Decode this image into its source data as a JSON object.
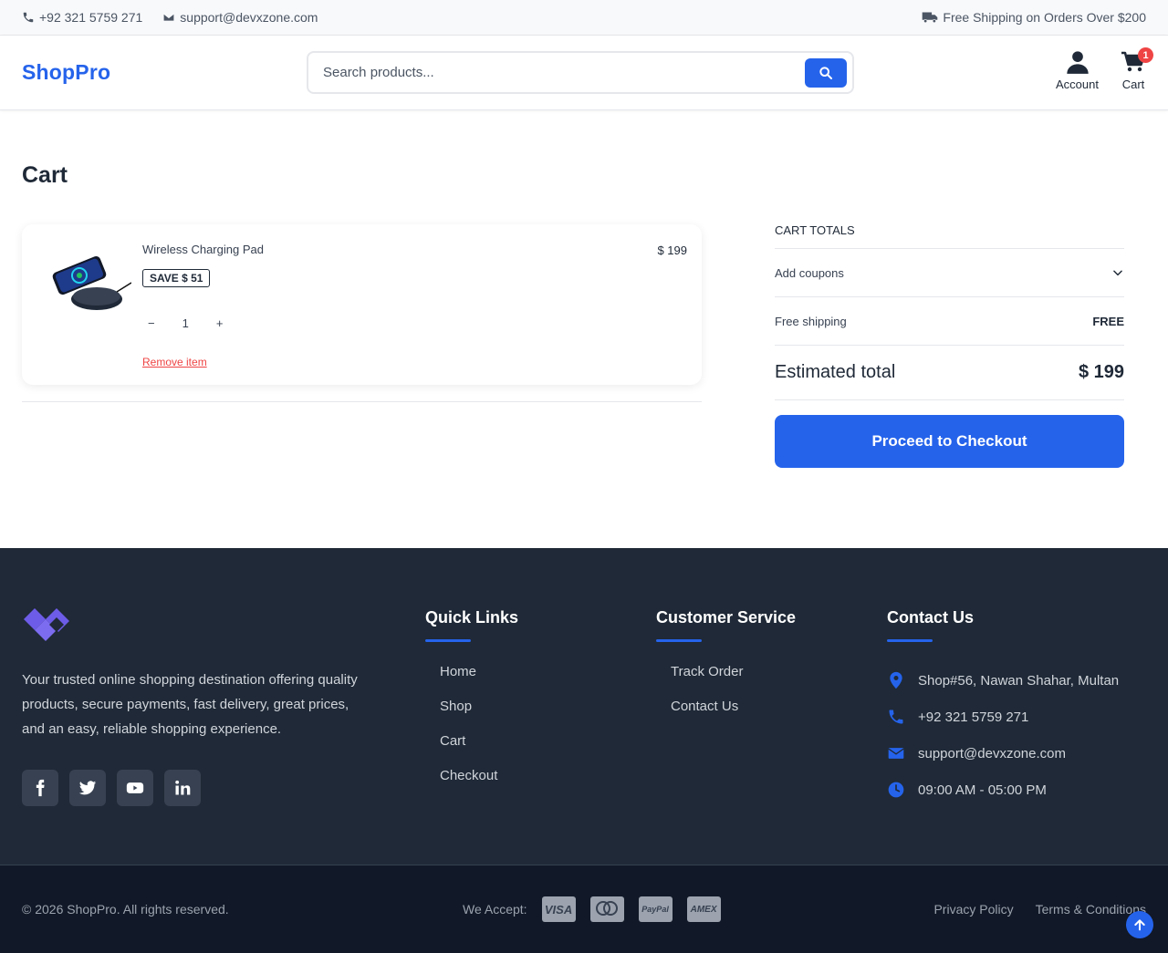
{
  "topbar": {
    "phone": "+92 321 5759 271",
    "email": "support@devxzone.com",
    "shipping": "Free Shipping on Orders Over $200"
  },
  "header": {
    "logo": "ShopPro",
    "search_placeholder": "Search products...",
    "account_label": "Account",
    "cart_label": "Cart",
    "cart_count": "1"
  },
  "cart": {
    "title": "Cart",
    "items": [
      {
        "name": "Wireless Charging Pad",
        "save": "SAVE $ 51",
        "qty": "1",
        "price": "$ 199",
        "remove": "Remove item",
        "decrement": "−",
        "increment": "+"
      }
    ]
  },
  "totals": {
    "title": "CART TOTALS",
    "coupons": "Add coupons",
    "shipping_label": "Free shipping",
    "shipping_value": "FREE",
    "estimated_label": "Estimated total",
    "estimated_value": "$ 199",
    "checkout": "Proceed to Checkout"
  },
  "footer": {
    "about": "Your trusted online shopping destination offering quality products, secure payments, fast delivery, great prices, and an easy, reliable shopping experience.",
    "quick_links": {
      "title": "Quick Links",
      "items": [
        "Home",
        "Shop",
        "Cart",
        "Checkout"
      ]
    },
    "customer_service": {
      "title": "Customer Service",
      "items": [
        "Track Order",
        "Contact Us"
      ]
    },
    "contact": {
      "title": "Contact Us",
      "address": "Shop#56, Nawan Shahar, Multan",
      "phone": "+92 321 5759 271",
      "email": "support@devxzone.com",
      "hours": "09:00 AM - 05:00 PM"
    },
    "socials": [
      "facebook-icon",
      "twitter-icon",
      "youtube-icon",
      "linkedin-icon"
    ]
  },
  "bottom": {
    "copyright": "© 2026 ShopPro. All rights reserved.",
    "accept_label": "We Accept:",
    "cards": [
      "VISA",
      "mastercard",
      "PayPal",
      "AMEX"
    ],
    "privacy": "Privacy Policy",
    "terms": "Terms & Conditions"
  },
  "colors": {
    "accent": "#2563eb",
    "footer_bg": "#1f2937",
    "badge": "#ef4444"
  }
}
